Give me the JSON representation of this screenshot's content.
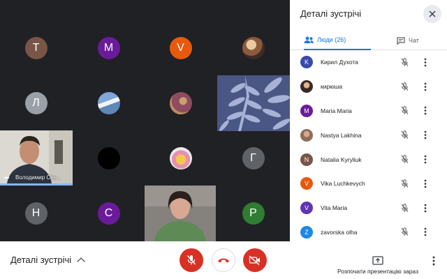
{
  "grid": {
    "tiles": [
      {
        "letter": "T",
        "color": "#795548"
      },
      {
        "letter": "M",
        "color": "#6a1b9a"
      },
      {
        "letter": "V",
        "color": "#e8590c"
      },
      {
        "letter": "Л",
        "color": "#9aa0a6"
      },
      {
        "letter": "Г",
        "color": "#5f6368"
      },
      {
        "letter": "H",
        "color": "#5f6368"
      },
      {
        "letter": "C",
        "color": "#6a1b9a"
      },
      {
        "letter": "P",
        "color": "#2e7d32"
      }
    ],
    "man_video_name": "Володимир Сен...",
    "man_video_dots": "•••"
  },
  "bottom_bar": {
    "meeting_details_label": "Деталі зустрічі",
    "present_label": "Розпочати презентацію зараз",
    "accent_red": "#d93025"
  },
  "panel": {
    "title": "Деталі зустрічі",
    "tabs": [
      {
        "label": "Люди (26)",
        "active": true
      },
      {
        "label": "Чат",
        "active": false
      }
    ],
    "accent_blue": "#1a73e8",
    "participants": [
      {
        "name": "Кирил Духота",
        "initial": "K",
        "color": "#3949ab",
        "photo": false
      },
      {
        "name": "кирюша",
        "initial": "",
        "color": "#444",
        "photo": true
      },
      {
        "name": "Maria Maria",
        "initial": "M",
        "color": "#6a1b9a",
        "photo": false
      },
      {
        "name": "Nastya Lakhina",
        "initial": "",
        "color": "#a1887f",
        "photo": true
      },
      {
        "name": "Natalia Kyryliuk",
        "initial": "N",
        "color": "#795548",
        "photo": false
      },
      {
        "name": "Vika Luchkevych",
        "initial": "V",
        "color": "#e8590c",
        "photo": false
      },
      {
        "name": "Vita Maria",
        "initial": "V",
        "color": "#5e35b1",
        "photo": false
      },
      {
        "name": "zavorska olha",
        "initial": "Z",
        "color": "#1e88e5",
        "photo": false
      }
    ]
  }
}
